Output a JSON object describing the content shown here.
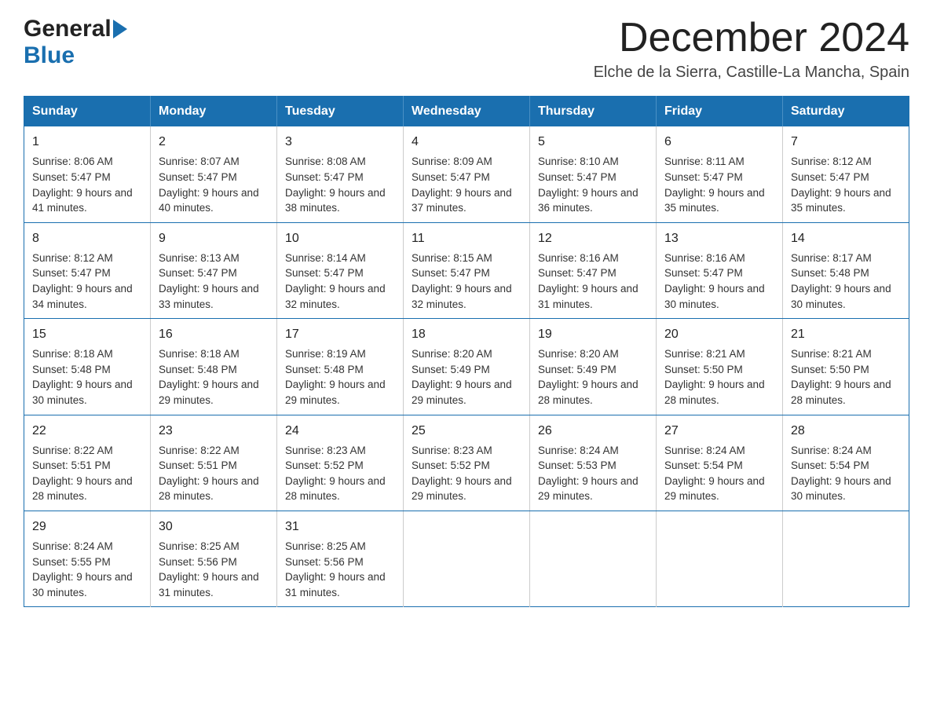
{
  "header": {
    "logo_general": "General",
    "logo_blue": "Blue",
    "month_title": "December 2024",
    "location": "Elche de la Sierra, Castille-La Mancha, Spain"
  },
  "days_of_week": [
    "Sunday",
    "Monday",
    "Tuesday",
    "Wednesday",
    "Thursday",
    "Friday",
    "Saturday"
  ],
  "weeks": [
    [
      {
        "day": "1",
        "sunrise": "8:06 AM",
        "sunset": "5:47 PM",
        "daylight": "9 hours and 41 minutes."
      },
      {
        "day": "2",
        "sunrise": "8:07 AM",
        "sunset": "5:47 PM",
        "daylight": "9 hours and 40 minutes."
      },
      {
        "day": "3",
        "sunrise": "8:08 AM",
        "sunset": "5:47 PM",
        "daylight": "9 hours and 38 minutes."
      },
      {
        "day": "4",
        "sunrise": "8:09 AM",
        "sunset": "5:47 PM",
        "daylight": "9 hours and 37 minutes."
      },
      {
        "day": "5",
        "sunrise": "8:10 AM",
        "sunset": "5:47 PM",
        "daylight": "9 hours and 36 minutes."
      },
      {
        "day": "6",
        "sunrise": "8:11 AM",
        "sunset": "5:47 PM",
        "daylight": "9 hours and 35 minutes."
      },
      {
        "day": "7",
        "sunrise": "8:12 AM",
        "sunset": "5:47 PM",
        "daylight": "9 hours and 35 minutes."
      }
    ],
    [
      {
        "day": "8",
        "sunrise": "8:12 AM",
        "sunset": "5:47 PM",
        "daylight": "9 hours and 34 minutes."
      },
      {
        "day": "9",
        "sunrise": "8:13 AM",
        "sunset": "5:47 PM",
        "daylight": "9 hours and 33 minutes."
      },
      {
        "day": "10",
        "sunrise": "8:14 AM",
        "sunset": "5:47 PM",
        "daylight": "9 hours and 32 minutes."
      },
      {
        "day": "11",
        "sunrise": "8:15 AM",
        "sunset": "5:47 PM",
        "daylight": "9 hours and 32 minutes."
      },
      {
        "day": "12",
        "sunrise": "8:16 AM",
        "sunset": "5:47 PM",
        "daylight": "9 hours and 31 minutes."
      },
      {
        "day": "13",
        "sunrise": "8:16 AM",
        "sunset": "5:47 PM",
        "daylight": "9 hours and 30 minutes."
      },
      {
        "day": "14",
        "sunrise": "8:17 AM",
        "sunset": "5:48 PM",
        "daylight": "9 hours and 30 minutes."
      }
    ],
    [
      {
        "day": "15",
        "sunrise": "8:18 AM",
        "sunset": "5:48 PM",
        "daylight": "9 hours and 30 minutes."
      },
      {
        "day": "16",
        "sunrise": "8:18 AM",
        "sunset": "5:48 PM",
        "daylight": "9 hours and 29 minutes."
      },
      {
        "day": "17",
        "sunrise": "8:19 AM",
        "sunset": "5:48 PM",
        "daylight": "9 hours and 29 minutes."
      },
      {
        "day": "18",
        "sunrise": "8:20 AM",
        "sunset": "5:49 PM",
        "daylight": "9 hours and 29 minutes."
      },
      {
        "day": "19",
        "sunrise": "8:20 AM",
        "sunset": "5:49 PM",
        "daylight": "9 hours and 28 minutes."
      },
      {
        "day": "20",
        "sunrise": "8:21 AM",
        "sunset": "5:50 PM",
        "daylight": "9 hours and 28 minutes."
      },
      {
        "day": "21",
        "sunrise": "8:21 AM",
        "sunset": "5:50 PM",
        "daylight": "9 hours and 28 minutes."
      }
    ],
    [
      {
        "day": "22",
        "sunrise": "8:22 AM",
        "sunset": "5:51 PM",
        "daylight": "9 hours and 28 minutes."
      },
      {
        "day": "23",
        "sunrise": "8:22 AM",
        "sunset": "5:51 PM",
        "daylight": "9 hours and 28 minutes."
      },
      {
        "day": "24",
        "sunrise": "8:23 AM",
        "sunset": "5:52 PM",
        "daylight": "9 hours and 28 minutes."
      },
      {
        "day": "25",
        "sunrise": "8:23 AM",
        "sunset": "5:52 PM",
        "daylight": "9 hours and 29 minutes."
      },
      {
        "day": "26",
        "sunrise": "8:24 AM",
        "sunset": "5:53 PM",
        "daylight": "9 hours and 29 minutes."
      },
      {
        "day": "27",
        "sunrise": "8:24 AM",
        "sunset": "5:54 PM",
        "daylight": "9 hours and 29 minutes."
      },
      {
        "day": "28",
        "sunrise": "8:24 AM",
        "sunset": "5:54 PM",
        "daylight": "9 hours and 30 minutes."
      }
    ],
    [
      {
        "day": "29",
        "sunrise": "8:24 AM",
        "sunset": "5:55 PM",
        "daylight": "9 hours and 30 minutes."
      },
      {
        "day": "30",
        "sunrise": "8:25 AM",
        "sunset": "5:56 PM",
        "daylight": "9 hours and 31 minutes."
      },
      {
        "day": "31",
        "sunrise": "8:25 AM",
        "sunset": "5:56 PM",
        "daylight": "9 hours and 31 minutes."
      },
      null,
      null,
      null,
      null
    ]
  ],
  "labels": {
    "sunrise_prefix": "Sunrise: ",
    "sunset_prefix": "Sunset: ",
    "daylight_prefix": "Daylight: "
  }
}
